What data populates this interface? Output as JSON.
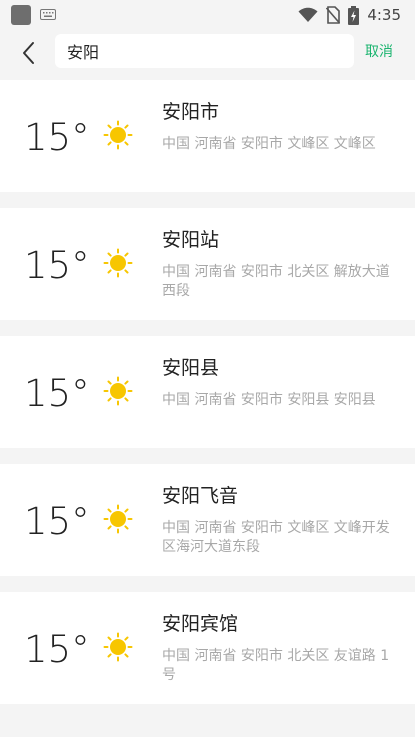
{
  "status_bar": {
    "time": "4:35",
    "icons": [
      "app-icon",
      "keyboard-icon",
      "wifi-icon",
      "no-sim-icon",
      "battery-charging-icon"
    ]
  },
  "search": {
    "value": "安阳",
    "cancel_label": "取消",
    "back_icon": "back-arrow-icon"
  },
  "results": [
    {
      "temp": "15°",
      "name": "安阳市",
      "address": "中国  河南省  安阳市  文峰区  文峰区",
      "weather_icon": "sun-icon"
    },
    {
      "temp": "15°",
      "name": "安阳站",
      "address": "中国  河南省  安阳市  北关区  解放大道西段",
      "weather_icon": "sun-icon"
    },
    {
      "temp": "15°",
      "name": "安阳县",
      "address": "中国  河南省  安阳市  安阳县  安阳县",
      "weather_icon": "sun-icon"
    },
    {
      "temp": "15°",
      "name": "安阳飞音",
      "address": "中国  河南省  安阳市  文峰区  文峰开发区海河大道东段",
      "weather_icon": "sun-icon"
    },
    {
      "temp": "15°",
      "name": "安阳宾馆",
      "address": "中国  河南省  安阳市  北关区  友谊路 1号",
      "weather_icon": "sun-icon"
    }
  ],
  "colors": {
    "accent": "#1bb46f",
    "sun": "#f7c600",
    "background": "#f4f4f4",
    "card": "#ffffff",
    "secondary_text": "#a8a8a8"
  }
}
